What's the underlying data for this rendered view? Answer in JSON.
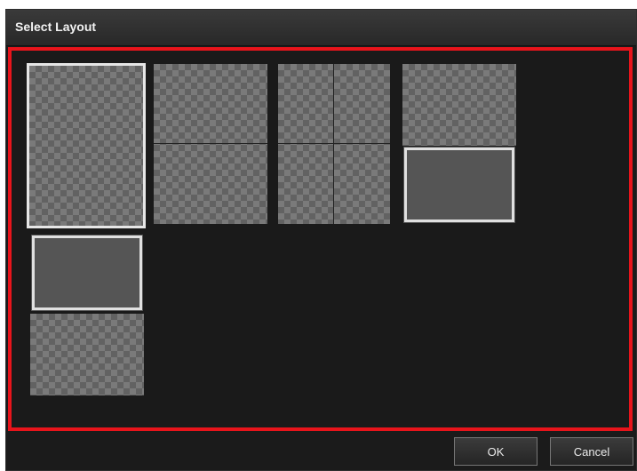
{
  "dialog": {
    "title": "Select Layout"
  },
  "layouts": [
    {
      "name": "single-photo",
      "photos": 1
    },
    {
      "name": "two-stacked",
      "photos": 2
    },
    {
      "name": "four-grid",
      "photos": 4
    },
    {
      "name": "photo-over-text-box",
      "photos": 1
    },
    {
      "name": "text-box-over-photo",
      "photos": 1
    }
  ],
  "buttons": {
    "ok_label": "OK",
    "cancel_label": "Cancel"
  },
  "colors": {
    "highlight_border": "#e8141b",
    "background": "#1b1b1b"
  }
}
